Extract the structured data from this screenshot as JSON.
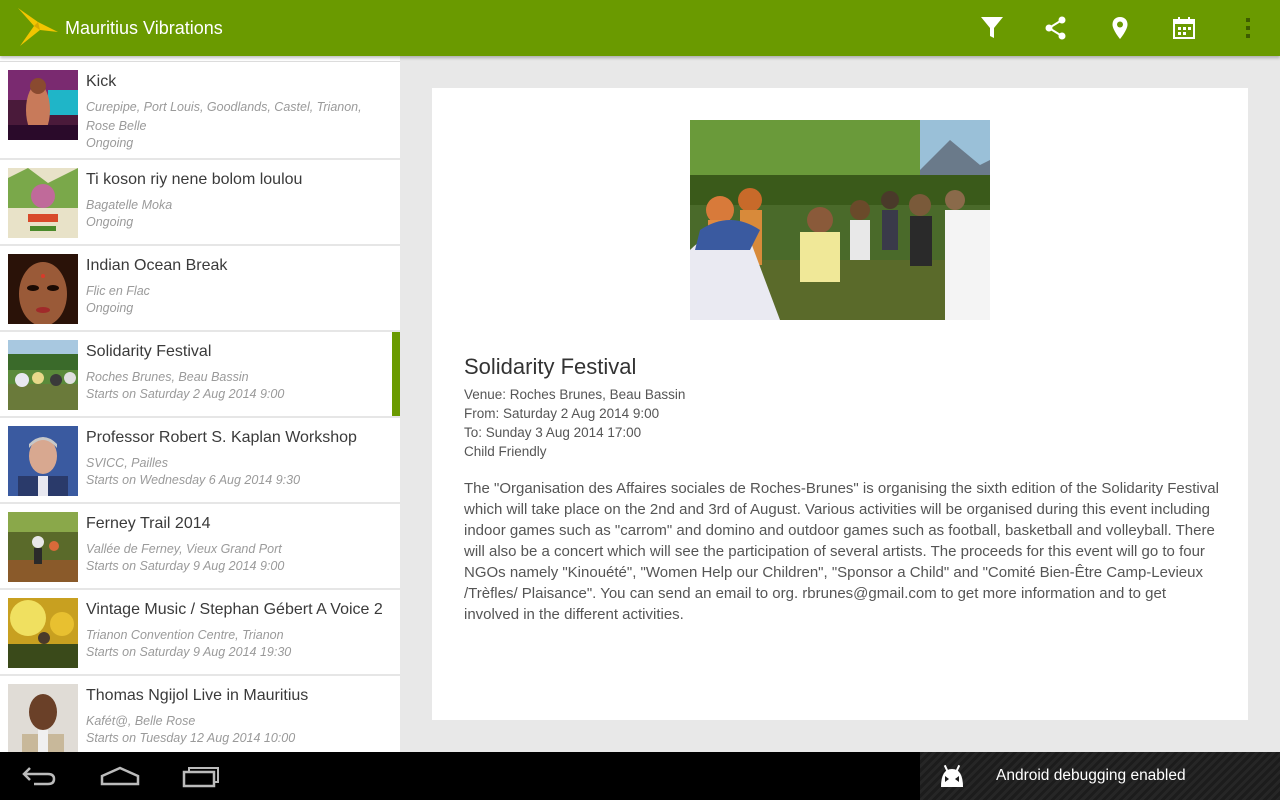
{
  "app": {
    "title": "Mauritius Vibrations",
    "accent_color": "#6a9a00",
    "actions": [
      "filter-icon",
      "share-icon",
      "location-pin-icon",
      "calendar-icon",
      "overflow-menu-icon"
    ]
  },
  "events": [
    {
      "title": "Kick",
      "venue": "Curepipe, Port Louis, Goodlands, Castel, Trianon, Rose Belle",
      "when": "Ongoing"
    },
    {
      "title": "Ti koson riy nene bolom loulou",
      "venue": "Bagatelle Moka",
      "when": "Ongoing"
    },
    {
      "title": "Indian Ocean Break",
      "venue": "Flic en Flac",
      "when": "Ongoing"
    },
    {
      "title": "Solidarity Festival",
      "venue": "Roches Brunes, Beau Bassin",
      "when": "Starts on Saturday 2 Aug 2014 9:00",
      "selected": true
    },
    {
      "title": "Professor Robert S. Kaplan Workshop",
      "venue": "SVICC, Pailles",
      "when": "Starts on Wednesday 6 Aug 2014 9:30"
    },
    {
      "title": "Ferney Trail 2014",
      "venue": "Vallée de Ferney, Vieux Grand Port",
      "when": "Starts on Saturday 9 Aug 2014 9:00"
    },
    {
      "title": "Vintage Music / Stephan Gébert A Voice 2",
      "venue": "Trianon Convention Centre, Trianon",
      "when": "Starts on Saturday 9 Aug 2014 19:30"
    },
    {
      "title": "Thomas Ngijol Live in Mauritius",
      "venue": "Kafét@, Belle Rose",
      "when": "Starts on Tuesday 12 Aug 2014 10:00"
    }
  ],
  "detail": {
    "title": "Solidarity Festival",
    "venue": "Venue: Roches Brunes, Beau Bassin",
    "from": "From: Saturday 2 Aug 2014 9:00",
    "to": "To: Sunday 3 Aug 2014 17:00",
    "tag": "Child Friendly",
    "description": "The \"Organisation des Affaires sociales de Roches-Brunes\" is organising the sixth edition of the Solidarity Festival which will take place on the 2nd and 3rd of August. Various activities will be organised during this event including indoor games such as \"carrom\" and domino and outdoor games such as football, basketball and volleyball. There will also be a concert which will see the participation of several artists. The proceeds for this event will go to four NGOs namely \"Kinouété\", \"Women Help our Children\", \"Sponsor a Child\" and \"Comité Bien-Être Camp-Levieux /Trèfles/ Plaisance\". You can send an email to org. rbrunes@gmail.com to get more information and to get involved in the different activities."
  },
  "navbar": {
    "buttons": [
      "back-icon",
      "home-icon",
      "recent-apps-icon"
    ],
    "notification": "Android debugging enabled"
  }
}
